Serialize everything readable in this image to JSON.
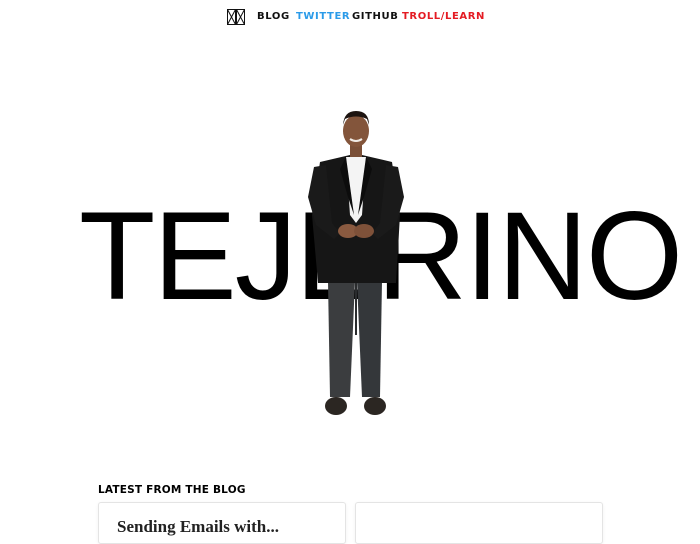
{
  "nav": {
    "logo_icon": "crossed-boxes-logo-icon",
    "links": [
      {
        "label": "BLOG",
        "color": "#111111"
      },
      {
        "label": "TWITTER",
        "color": "#2b9be9"
      },
      {
        "label": "GITHUB",
        "color": "#111111"
      },
      {
        "label": "TROLL/LEARN",
        "color": "#e41b23"
      }
    ]
  },
  "hero": {
    "title": "TEJERINO",
    "image": "standing-person-photo"
  },
  "blog": {
    "heading": "LATEST FROM THE BLOG",
    "cards": [
      {
        "title": "Sending Emails with..."
      },
      {
        "title": ""
      }
    ]
  }
}
